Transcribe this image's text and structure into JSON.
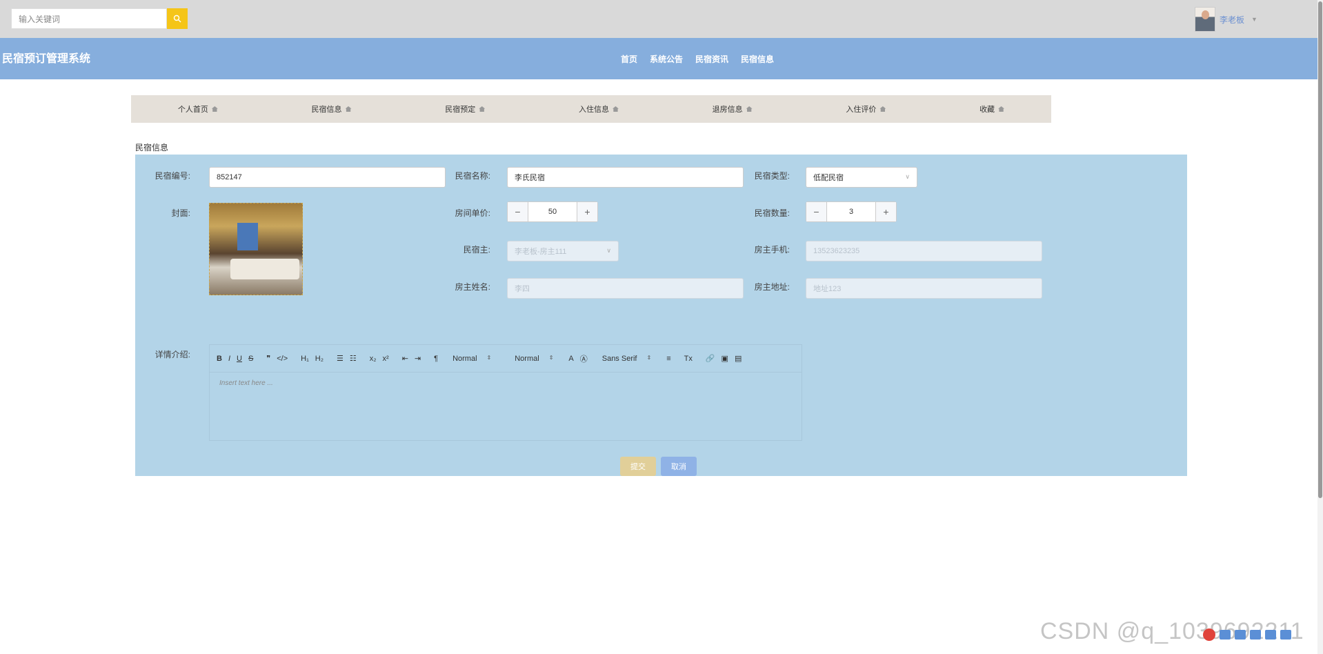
{
  "topbar": {
    "search_placeholder": "输入关键词",
    "user_name": "李老板"
  },
  "header": {
    "site_title": "民宿预订管理系统",
    "nav": [
      "首页",
      "系统公告",
      "民宿资讯",
      "民宿信息"
    ]
  },
  "subnav": [
    "个人首页",
    "民宿信息",
    "民宿预定",
    "入住信息",
    "退房信息",
    "入住评价",
    "收藏"
  ],
  "form": {
    "section_title": "民宿信息",
    "labels": {
      "code": "民宿编号:",
      "name": "民宿名称:",
      "type": "民宿类型:",
      "cover": "封面:",
      "price": "房间单价:",
      "quantity": "民宿数量:",
      "owner": "民宿主:",
      "owner_phone": "房主手机:",
      "owner_name": "房主姓名:",
      "owner_address": "房主地址:",
      "details": "详情介绍:"
    },
    "values": {
      "code": "852147",
      "name": "李氏民宿",
      "type": "低配民宿",
      "price": "50",
      "quantity": "3",
      "owner": "李老板-房主111",
      "owner_phone": "13523623235",
      "owner_name": "李四",
      "owner_address": "地址123"
    },
    "editor": {
      "header_select": "Normal",
      "size_select": "Normal",
      "font_select": "Sans Serif",
      "placeholder": "Insert text here ..."
    },
    "submit_label": "提交",
    "cancel_label": "取消"
  },
  "watermark": "CSDN @q_1039692211"
}
